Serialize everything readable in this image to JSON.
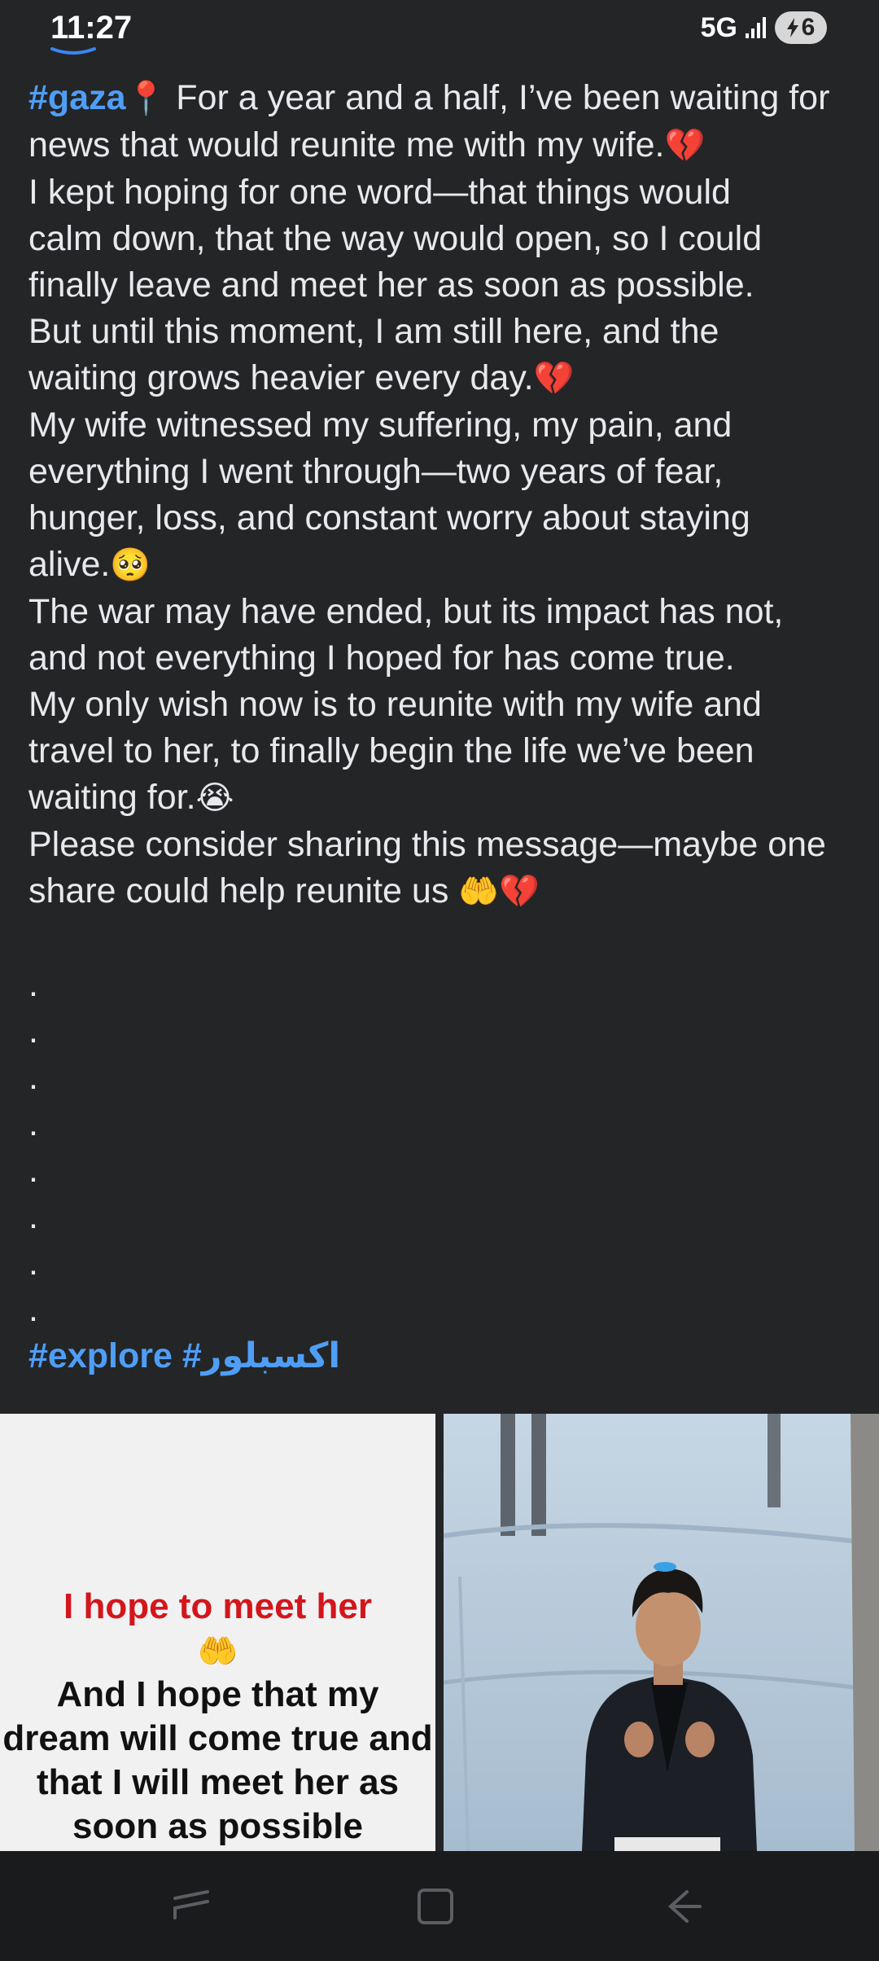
{
  "status_bar": {
    "time": "11:27",
    "network": "5G",
    "battery": "6"
  },
  "post": {
    "hashtag_first": "#gaza",
    "pin_emoji": "📍",
    "lines": [
      " For a year and a half, I’ve been waiting for",
      "news that would reunite me with my wife.",
      "I kept hoping for one word—that things would",
      "calm down, that the way would open, so I could",
      "finally leave and meet her as soon as possible.",
      "But until this moment, I am still here, and the",
      "waiting grows heavier every day.",
      "My wife witnessed my suffering, my pain, and",
      "everything I went through—two years of fear,",
      "hunger, loss, and constant worry about staying",
      "alive.",
      "The war may have ended, but its impact has not,",
      "and not everything I hoped for has come true.",
      "My only wish now is to reunite with my wife and",
      "travel to her, to finally begin the life we’ve been",
      "waiting for.",
      "Please consider sharing this message—maybe one",
      "share could help reunite us "
    ],
    "emojis": {
      "broken_heart": "💔",
      "pleading": "🥺",
      "crying": "😭",
      "hands": "🤲"
    },
    "dots": [
      ".",
      ".",
      ".",
      ".",
      ".",
      ".",
      ".",
      "."
    ],
    "hashtags": {
      "explore": "#explore",
      "arabic": "#اكسبلور"
    }
  },
  "image_left": {
    "red_text": "I hope to meet her",
    "hands_emoji": "🤲",
    "black_lines": [
      "And I hope that my",
      "dream will come true and",
      "that I will meet her as",
      "soon as possible"
    ]
  },
  "colors": {
    "background": "#242527",
    "hashtag": "#4f9ef6",
    "nav_bar": "#1a1b1d"
  },
  "nav": {
    "icons": [
      "recent-apps-icon",
      "home-icon",
      "back-icon"
    ]
  }
}
